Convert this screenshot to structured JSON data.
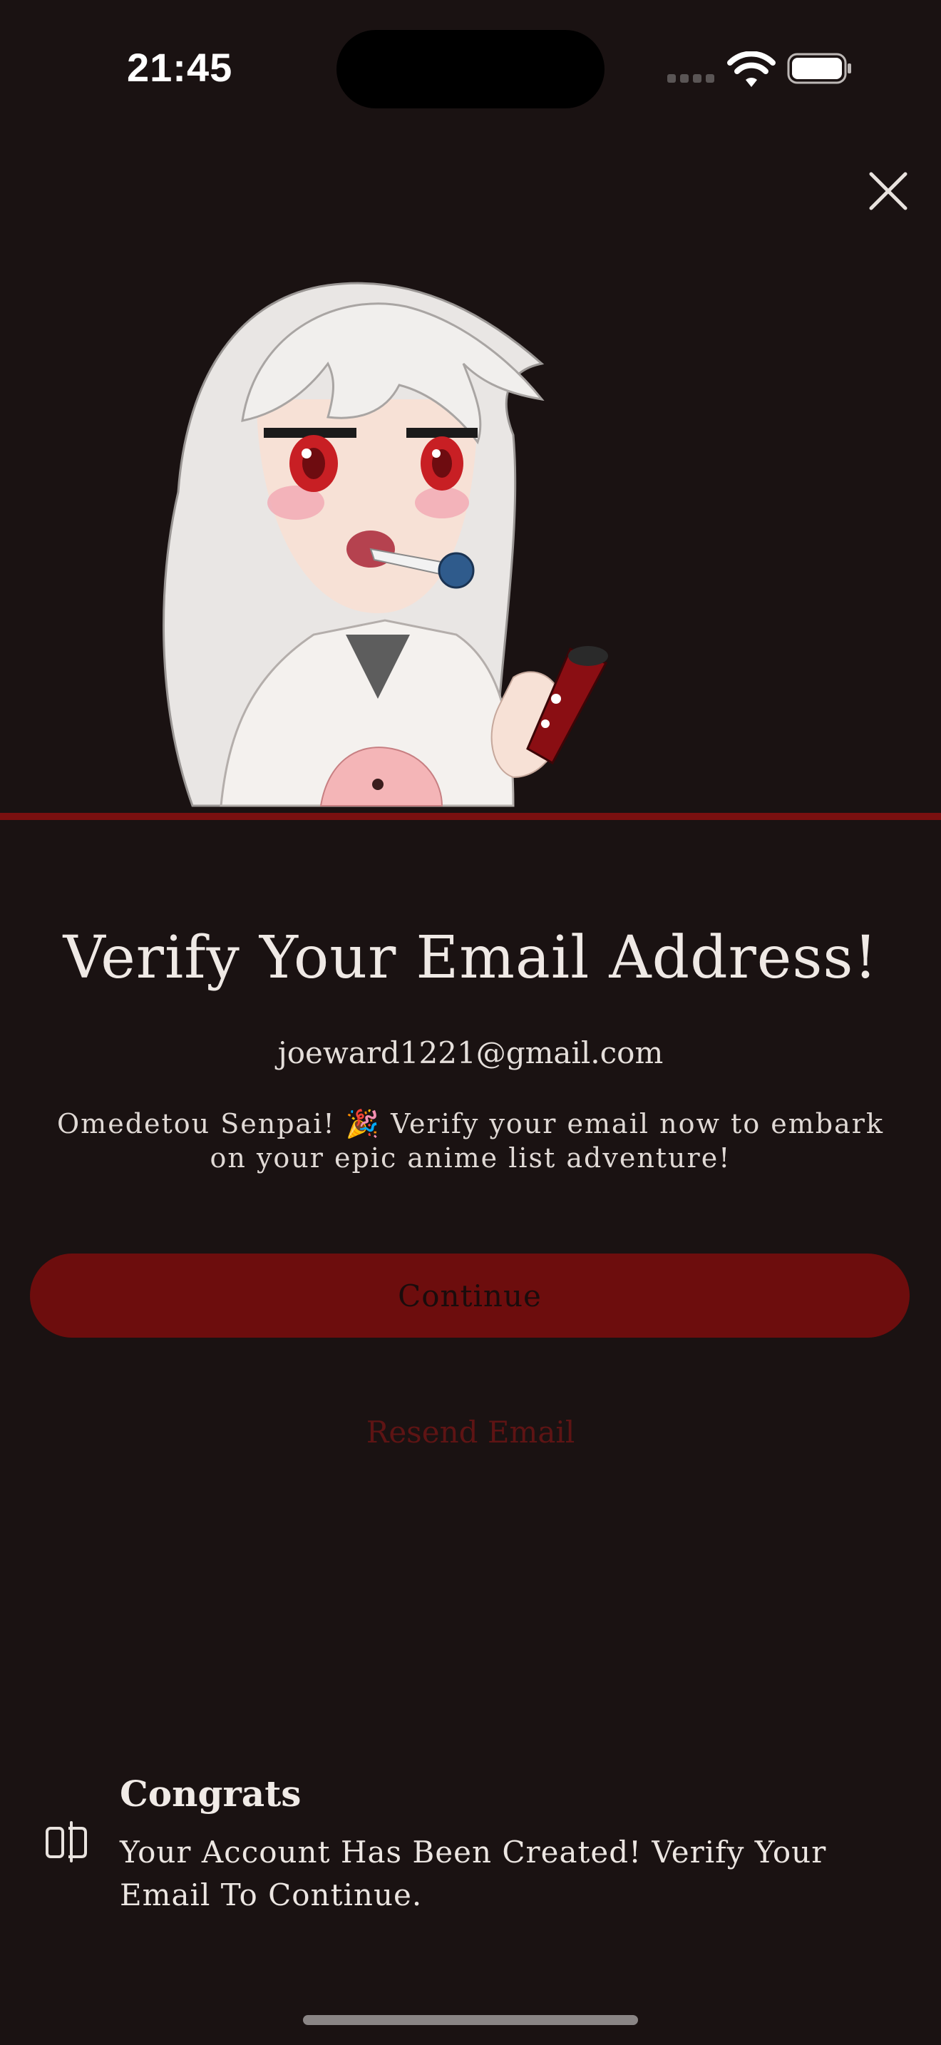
{
  "status_bar": {
    "time": "21:45"
  },
  "dialog": {
    "title": "Verify Your Email Address!",
    "email": "joeward1221@gmail.com",
    "subtitle": "Omedetou Senpai! 🎉 Verify your email now to embark on your epic anime list adventure!",
    "continue_label": "Continue",
    "resend_label": "Resend Email"
  },
  "toast": {
    "title": "Congrats",
    "message": "Your Account Has Been Created! Verify Your Email To Continue."
  },
  "colors": {
    "background": "#1a1212",
    "accent": "#7a1010",
    "button": "#6d0d0d",
    "link": "#5e1414"
  },
  "icons": [
    "close-icon",
    "anime-girl-illustration",
    "toast-icon",
    "wifi-icon",
    "battery-icon",
    "signal-icon"
  ]
}
